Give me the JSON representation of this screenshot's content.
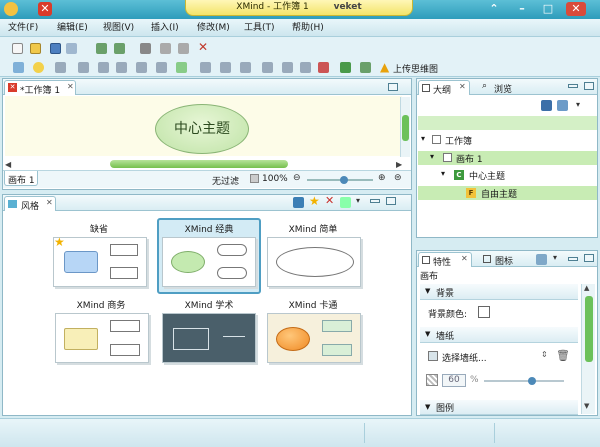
{
  "window": {
    "title": "XMind - 工作簿 1",
    "user": "veket"
  },
  "menu": [
    "文件(F)",
    "编辑(E)",
    "视图(V)",
    "插入(I)",
    "修改(M)",
    "工具(T)",
    "帮助(H)"
  ],
  "toolbar": {
    "upload_map": "上传思维图"
  },
  "editor": {
    "tab_label": "*工作簿 1",
    "central_topic": "中心主题",
    "sheet_tab": "画布 1",
    "filter_label": "无过滤",
    "zoom": "100%"
  },
  "style_panel": {
    "tab_label": "风格",
    "styles": [
      {
        "name": "缺省"
      },
      {
        "name": "XMind 经典"
      },
      {
        "name": "XMind 简单"
      },
      {
        "name": "XMind 商务"
      },
      {
        "name": "XMind 学术"
      },
      {
        "name": "XMind 卡通"
      }
    ],
    "selected_index": 1
  },
  "outline_panel": {
    "tab_outline": "大纲",
    "tab_browse": "浏览",
    "tree": [
      {
        "label": "工作簿",
        "level": 0
      },
      {
        "label": "画布 1",
        "level": 1
      },
      {
        "label": "中心主题",
        "level": 2
      },
      {
        "label": "自由主题",
        "level": 3
      }
    ]
  },
  "properties_panel": {
    "tab_properties": "特性",
    "tab_icons": "图标",
    "section_title": "画布",
    "background": {
      "header": "背景",
      "color_label": "背景颜色:"
    },
    "wallpaper": {
      "header": "墙纸",
      "select_label": "选择墙纸...",
      "opacity": "60",
      "opacity_unit": "%",
      "opacity_level": 0.6
    },
    "legend": {
      "header": "图例"
    }
  },
  "colors": {
    "accent": "#2e9cbb",
    "central_topic": "#bfe3a6",
    "selection": "#c8ecb4"
  }
}
